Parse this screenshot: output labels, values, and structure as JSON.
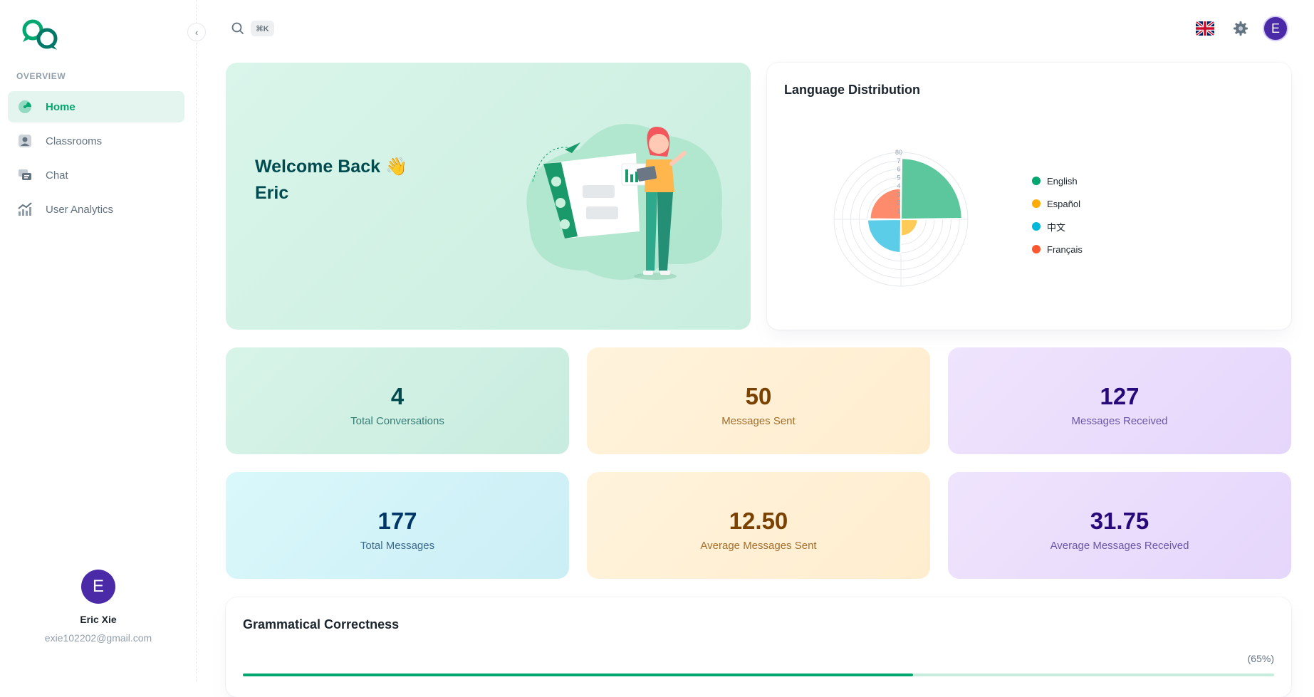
{
  "sidebar": {
    "section_label": "OVERVIEW",
    "collapse_icon": "chevron-left-icon",
    "items": [
      {
        "label": "Home",
        "icon": "dashboard-icon",
        "active": true
      },
      {
        "label": "Classrooms",
        "icon": "user-icon",
        "active": false
      },
      {
        "label": "Chat",
        "icon": "chat-icon",
        "active": false
      },
      {
        "label": "User Analytics",
        "icon": "analytics-icon",
        "active": false
      }
    ],
    "user": {
      "initial": "E",
      "name": "Eric Xie",
      "email": "exie102202@gmail.com"
    }
  },
  "header": {
    "search_icon": "search-icon",
    "shortcut": "⌘K",
    "language_flag": "uk-flag-icon",
    "settings_icon": "gear-icon",
    "avatar_initial": "E"
  },
  "welcome": {
    "line1": "Welcome Back 👋",
    "line2": "Eric"
  },
  "language_card": {
    "title": "Language Distribution",
    "legend": [
      {
        "label": "English",
        "color": "#00a76f"
      },
      {
        "label": "Español",
        "color": "#ffab00"
      },
      {
        "label": "中文",
        "color": "#00b8d9"
      },
      {
        "label": "Français",
        "color": "#ff5630"
      }
    ]
  },
  "chart_data": {
    "type": "polar-area",
    "categories": [
      "English",
      "Español",
      "中文",
      "Français"
    ],
    "values": [
      73,
      20,
      40,
      37
    ],
    "colors": [
      "#5cc69c",
      "#ffcb57",
      "#5ccde8",
      "#ff8b6d"
    ],
    "rlim": [
      0,
      80
    ],
    "r_ticks": [
      "80",
      "7",
      "6",
      "5",
      "4",
      "3",
      "2",
      "1"
    ]
  },
  "stats": [
    {
      "value": "4",
      "label": "Total Conversations",
      "theme": "green"
    },
    {
      "value": "50",
      "label": "Messages Sent",
      "theme": "yellow"
    },
    {
      "value": "127",
      "label": "Messages Received",
      "theme": "purple"
    },
    {
      "value": "177",
      "label": "Total Messages",
      "theme": "cyan"
    },
    {
      "value": "12.50",
      "label": "Average Messages Sent",
      "theme": "yellow"
    },
    {
      "value": "31.75",
      "label": "Average Messages Received",
      "theme": "purple"
    }
  ],
  "grammar": {
    "title": "Grammatical Correctness",
    "percent_text": "(65%)",
    "progress": 0.65
  }
}
